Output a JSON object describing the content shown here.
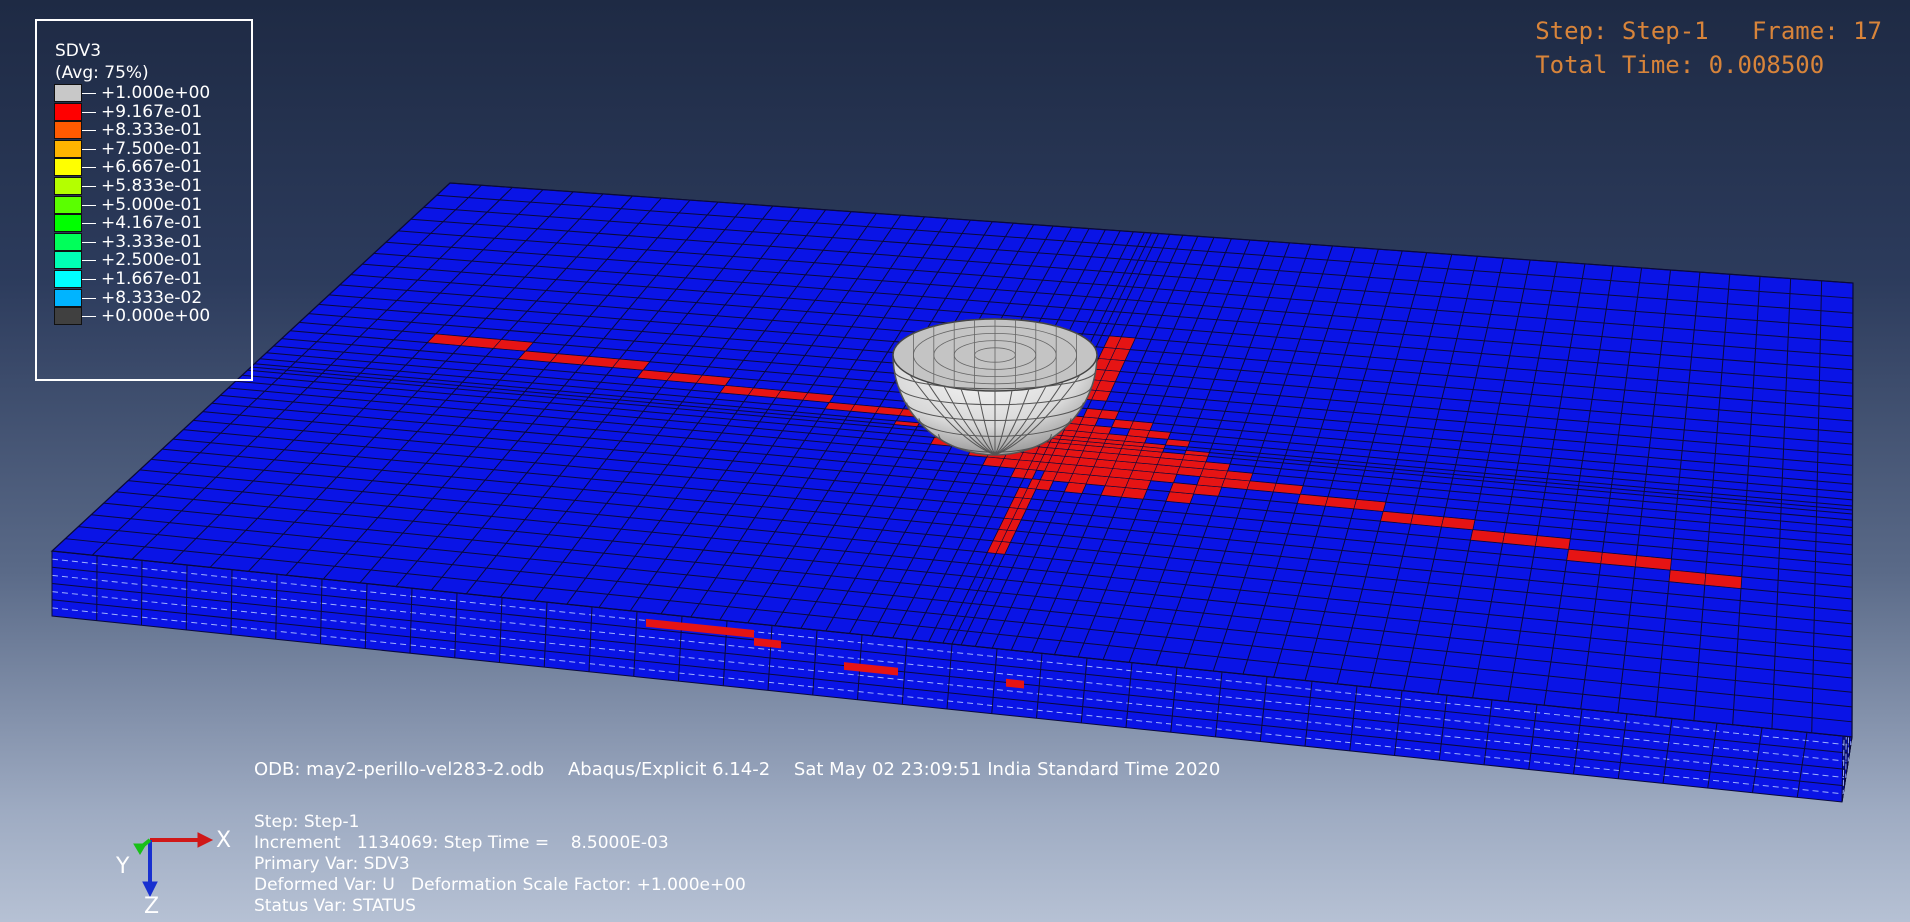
{
  "legend": {
    "variable": "SDV3",
    "averaging": "(Avg: 75%)",
    "entries": [
      {
        "label": "+1.000e+00",
        "color": "#c8c8c8"
      },
      {
        "label": "+9.167e-01",
        "color": "#ff0000"
      },
      {
        "label": "+8.333e-01",
        "color": "#ff5a00"
      },
      {
        "label": "+7.500e-01",
        "color": "#ffb400"
      },
      {
        "label": "+6.667e-01",
        "color": "#ffff00"
      },
      {
        "label": "+5.833e-01",
        "color": "#b4ff00"
      },
      {
        "label": "+5.000e-01",
        "color": "#5aff00"
      },
      {
        "label": "+4.167e-01",
        "color": "#00ff00"
      },
      {
        "label": "+3.333e-01",
        "color": "#00ff5a"
      },
      {
        "label": "+2.500e-01",
        "color": "#00ffb4"
      },
      {
        "label": "+1.667e-01",
        "color": "#00ffff"
      },
      {
        "label": "+8.333e-02",
        "color": "#00b4ff"
      },
      {
        "label": "+0.000e+00",
        "color": "#0000ff"
      }
    ],
    "bottom_color": "#404040"
  },
  "step_info": {
    "step_line": "Step: Step-1   Frame: 17",
    "time_line": "Total Time: 0.008500"
  },
  "odb_line": {
    "odb": "ODB: may2-perillo-vel283-2.odb",
    "solver": "Abaqus/Explicit 6.14-2",
    "date": "Sat May 02 23:09:51 India Standard Time 2020"
  },
  "status_block": {
    "step": "Step: Step-1",
    "increment": "Increment   1134069: Step Time =    8.5000E-03",
    "primary_var": "Primary Var: SDV3",
    "deformed_var": "Deformed Var: U   Deformation Scale Factor: +1.000e+00",
    "status_var": "Status Var: STATUS"
  },
  "triad": {
    "x_label": "X",
    "y_label": "Y",
    "z_label": "Z",
    "x_color": "#d01818",
    "y_color": "#18c018",
    "z_color": "#1830d0"
  },
  "colors": {
    "plate": "#0a14e6",
    "damage": "#e61414",
    "impactor": "#d8d8d8",
    "mesh_line": "#0a0a3a"
  }
}
